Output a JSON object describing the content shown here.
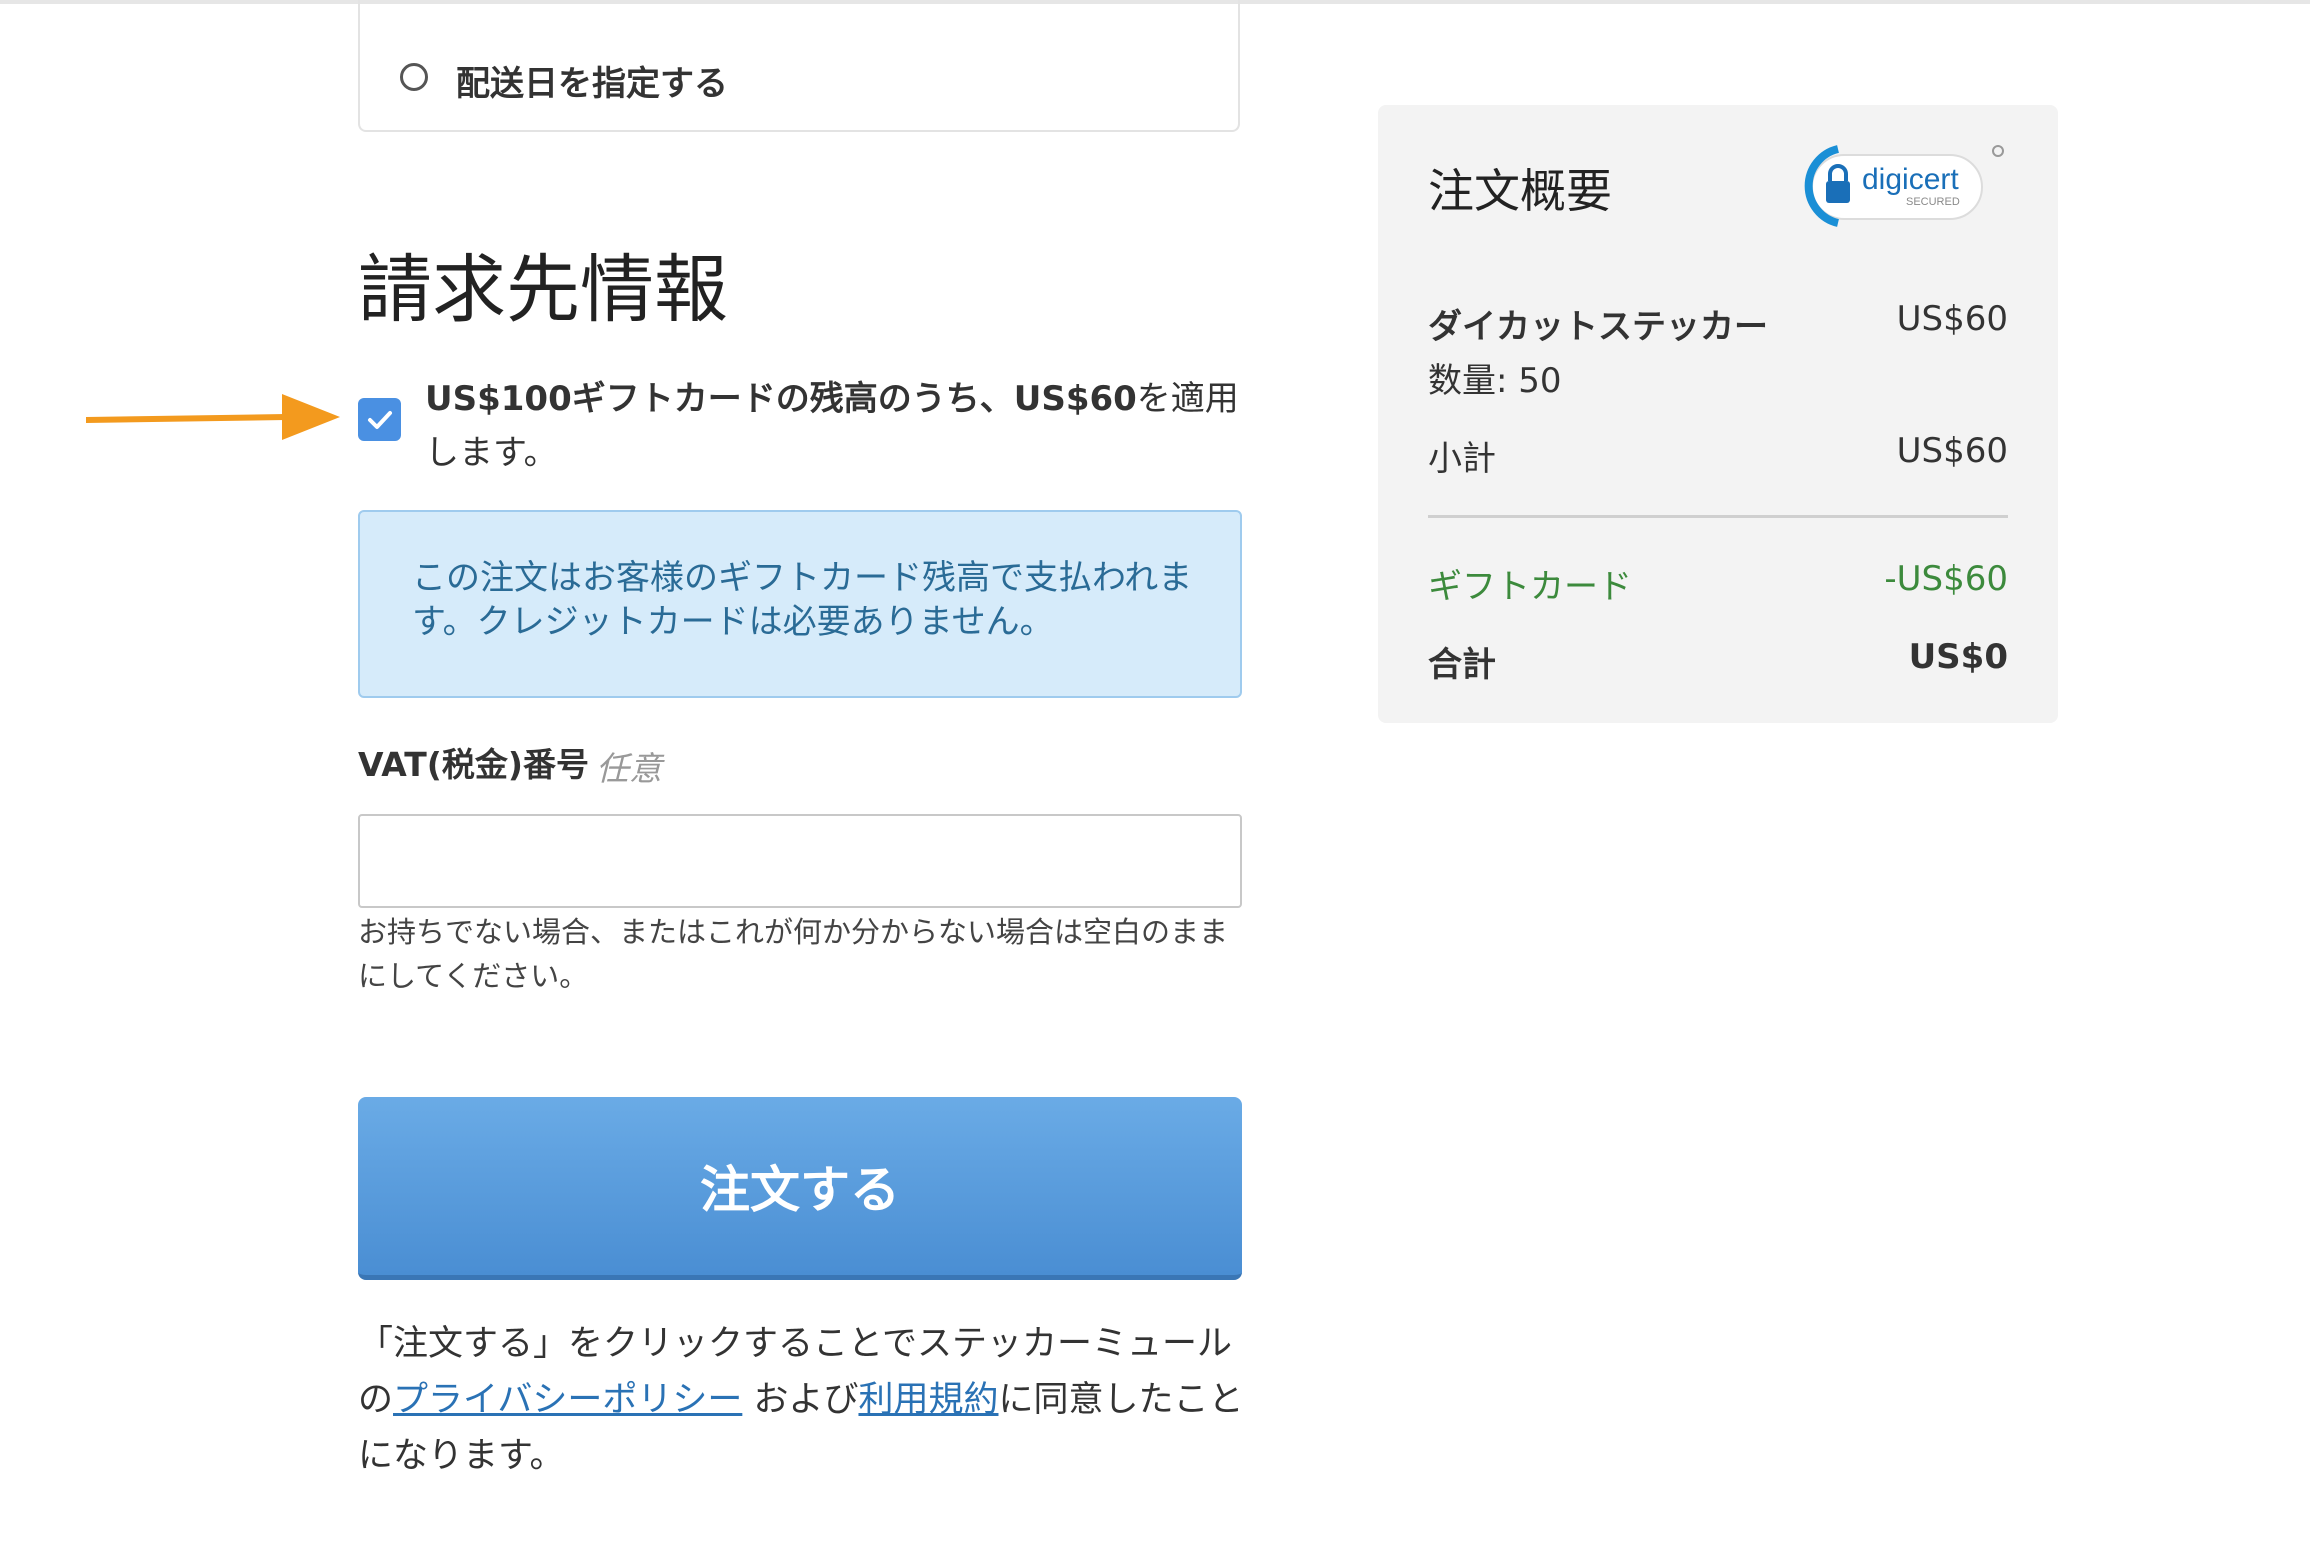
{
  "delivery": {
    "specify_date_label": "配送日を指定する"
  },
  "billing": {
    "title": "請求先情報",
    "gift_card": {
      "text_bold_part1": "US$100ギフトカードの残高のうち、US$60",
      "text_part2": "を適用します。",
      "checked": true
    },
    "info_message": "この注文はお客様のギフトカード残高で支払われます。クレジットカードは必要ありません。",
    "vat": {
      "label": "VAT(税金)番号",
      "optional": "任意",
      "value": "",
      "help": "お持ちでない場合、またはこれが何か分からない場合は空白のままにしてください。"
    }
  },
  "order_button": {
    "label": "注文する"
  },
  "agreement": {
    "prefix": "「注文する」をクリックすることでステッカーミュールの",
    "privacy_link": "プライバシーポリシー",
    "middle": " および",
    "terms_link": "利用規約",
    "suffix": "に同意したことになります。"
  },
  "summary": {
    "title": "注文概要",
    "badge_text": "digicert",
    "badge_sub": "SECURED",
    "item_name": "ダイカットステッカー",
    "item_price": "US$60",
    "quantity": "数量: 50",
    "subtotal_label": "小計",
    "subtotal_value": "US$60",
    "gift_card_label": "ギフトカード",
    "gift_card_value": "-US$60",
    "total_label": "合計",
    "total_value": "US$0"
  },
  "colors": {
    "accent_blue": "#4a90e2",
    "arrow_orange": "#f39a1e",
    "gift_green": "#3c8a3c"
  }
}
